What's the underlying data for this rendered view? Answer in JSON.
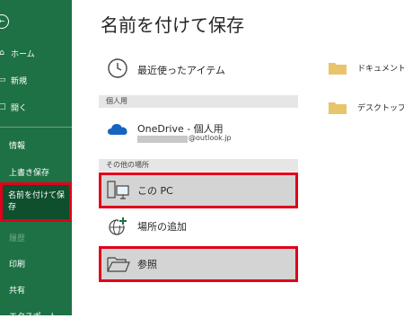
{
  "sidebar": {
    "back_icon": "back-arrow-icon",
    "items": [
      {
        "label": "ホーム",
        "icon": "home-icon"
      },
      {
        "label": "新規",
        "icon": "new-icon"
      },
      {
        "label": "開く",
        "icon": "open-icon"
      }
    ],
    "info": "情報",
    "overwrite": "上書き保存",
    "save_as": "名前を付けて保存",
    "history": "履歴",
    "print": "印刷",
    "share": "共有",
    "export": "エクスポート"
  },
  "main": {
    "title": "名前を付けて保存",
    "recent": "最近使ったアイテム",
    "personal_header": "個人用",
    "onedrive_title": "OneDrive - 個人用",
    "onedrive_email": "@outlook.jp",
    "other_header": "その他の場所",
    "this_pc": "この PC",
    "add_place": "場所の追加",
    "browse": "参照"
  },
  "folders": [
    {
      "label": "ドキュメント"
    },
    {
      "label": "デスクトップ"
    }
  ],
  "colors": {
    "sidebar": "#1e7145",
    "sidebar_active": "#0e4f2d",
    "highlight": "#e0001b",
    "folder": "#e8c46a"
  }
}
